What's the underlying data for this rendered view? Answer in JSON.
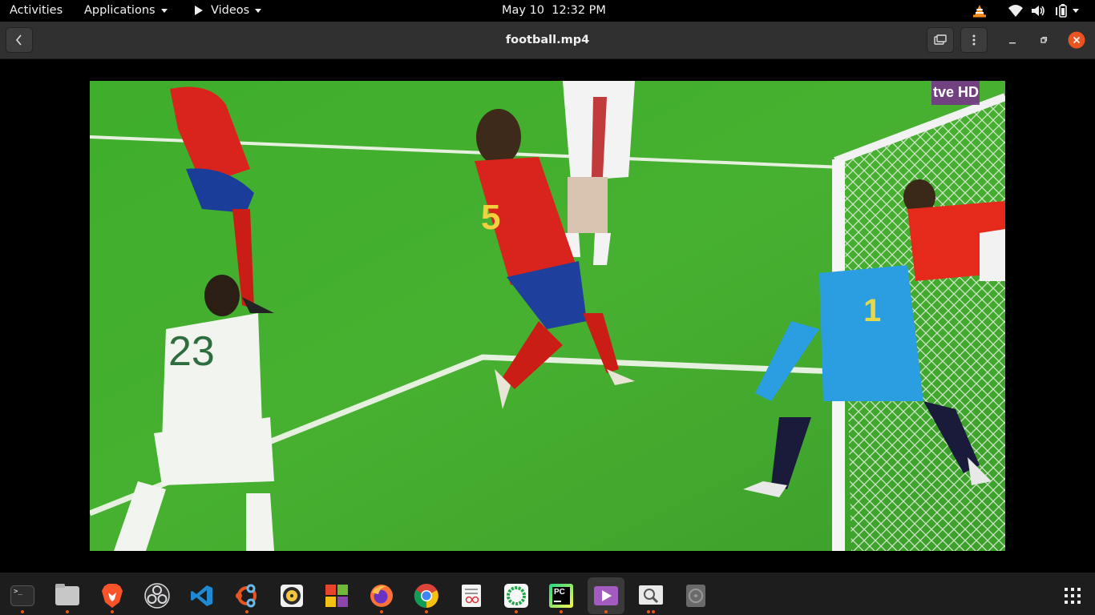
{
  "topbar": {
    "activities": "Activities",
    "applications": "Applications",
    "videos": "Videos",
    "clock": "May 10  12:32 PM"
  },
  "window": {
    "title": "football.mp4"
  },
  "video": {
    "player_left_number": "23",
    "player_center_number": "5",
    "goalkeeper_number": "1",
    "broadcaster_logo": "tve HD"
  },
  "dock": {
    "items": [
      {
        "name": "terminal",
        "label": ">_"
      },
      {
        "name": "files"
      },
      {
        "name": "brave-browser"
      },
      {
        "name": "obs-studio"
      },
      {
        "name": "vscode"
      },
      {
        "name": "ubuntu-software"
      },
      {
        "name": "rhythmbox"
      },
      {
        "name": "photo-collage"
      },
      {
        "name": "firefox"
      },
      {
        "name": "chrome"
      },
      {
        "name": "document-viewer"
      },
      {
        "name": "circle-app"
      },
      {
        "name": "pycharm",
        "label": "PC"
      },
      {
        "name": "videos"
      },
      {
        "name": "image-viewer"
      },
      {
        "name": "disk-utility"
      },
      {
        "name": "show-applications"
      }
    ]
  },
  "colors": {
    "accent": "#e95420",
    "close_button": "#e95420",
    "pitch_green": "#3faa2e",
    "spain_red": "#d8241c"
  }
}
